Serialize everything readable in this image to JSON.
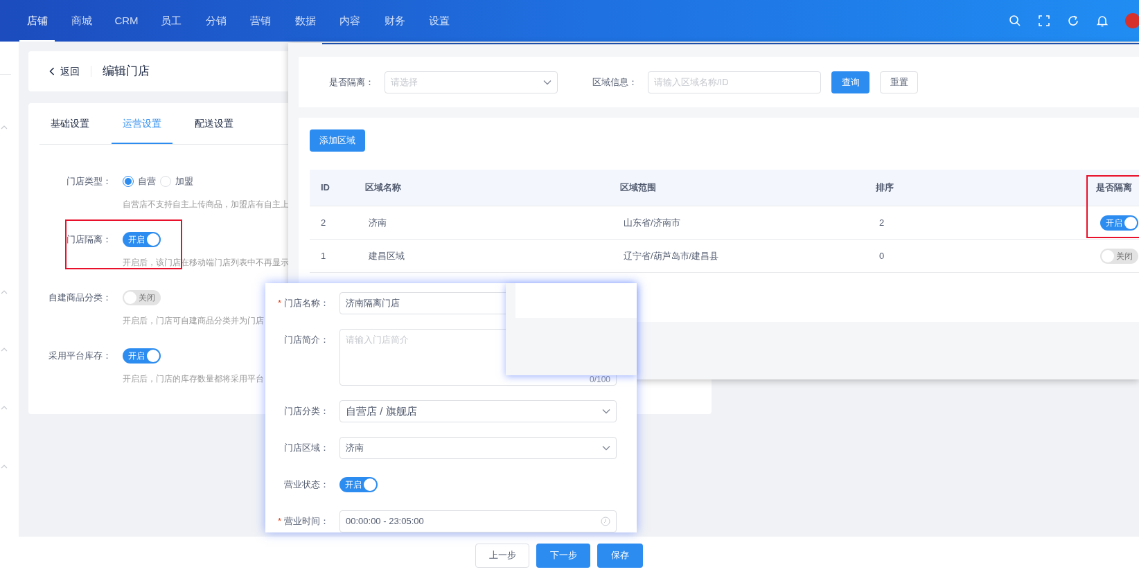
{
  "nav": {
    "items": [
      {
        "label": "店铺",
        "selected": true
      },
      {
        "label": "商城",
        "selected": false
      },
      {
        "label": "CRM",
        "selected": false
      },
      {
        "label": "员工",
        "selected": false
      },
      {
        "label": "分销",
        "selected": false
      },
      {
        "label": "营销",
        "selected": false
      },
      {
        "label": "数据",
        "selected": false
      },
      {
        "label": "内容",
        "selected": false
      },
      {
        "label": "财务",
        "selected": false
      },
      {
        "label": "设置",
        "selected": false
      }
    ]
  },
  "header": {
    "back": "返回",
    "title": "编辑门店"
  },
  "tabs": [
    {
      "label": "基础设置",
      "selected": false
    },
    {
      "label": "运营设置",
      "selected": true
    },
    {
      "label": "配送设置",
      "selected": false
    }
  ],
  "settings": {
    "rows": [
      {
        "kind": "radio",
        "label": "门店类型：",
        "options": [
          {
            "label": "自营",
            "selected": true
          },
          {
            "label": "加盟",
            "selected": false
          }
        ],
        "hint": "自营店不支持自主上传商品，加盟店有自主上"
      },
      {
        "kind": "switch",
        "label": "门店隔离：",
        "on": true,
        "switch_text": "开启",
        "hint": "开启后，该门店在移动端门店列表中不再显示",
        "highlighted": true
      },
      {
        "kind": "switch",
        "label": "自建商品分类：",
        "on": false,
        "switch_text": "关闭",
        "hint": "开启后，门店可自建商品分类并为门店",
        "highlighted": false
      },
      {
        "kind": "switch",
        "label": "采用平台库存：",
        "on": true,
        "switch_text": "开启",
        "hint": "开启后，门店的库存数量都将采用平台",
        "highlighted": false
      }
    ]
  },
  "region_panel": {
    "filters": [
      {
        "kind": "select",
        "label": "是否隔离：",
        "placeholder": "请选择"
      },
      {
        "kind": "input",
        "label": "区域信息：",
        "placeholder": "请输入区域名称/ID"
      }
    ],
    "buttons": [
      {
        "kind": "primary",
        "label": "查询"
      },
      {
        "kind": "default",
        "label": "重置"
      }
    ],
    "add_button": "添加区域",
    "table": {
      "columns": [
        "ID",
        "区域名称",
        "区域范围",
        "排序",
        "是否隔离"
      ],
      "rows": [
        {
          "cells": [
            "2",
            "济南",
            "山东省/济南市",
            "2"
          ],
          "isolation": {
            "on": true,
            "text": "开启"
          },
          "highlighted": true
        },
        {
          "cells": [
            "1",
            "建昌区域",
            "辽宁省/葫芦岛市/建昌县",
            "0"
          ],
          "isolation": {
            "on": false,
            "text": "关闭"
          },
          "highlighted": false
        }
      ]
    }
  },
  "store_form": {
    "required_mark": "*",
    "fields": [
      {
        "kind": "input",
        "label": "门店名称：",
        "required": true,
        "value": "济南隔离门店"
      },
      {
        "kind": "textarea",
        "label": "门店简介：",
        "required": false,
        "placeholder": "请输入门店简介",
        "counter": "0/100"
      },
      {
        "kind": "select",
        "label": "门店分类：",
        "required": false,
        "value": "自营店 / 旗舰店"
      },
      {
        "kind": "select",
        "label": "门店区域：",
        "required": false,
        "value": "济南"
      },
      {
        "kind": "switch",
        "label": "营业状态：",
        "required": false,
        "on": true,
        "switch_text": "开启"
      },
      {
        "kind": "time",
        "label": "营业时间：",
        "required": true,
        "value": "00:00:00 - 23:05:00"
      }
    ]
  },
  "footer": {
    "buttons": [
      {
        "kind": "default",
        "label": "上一步"
      },
      {
        "kind": "primary",
        "label": "下一步"
      },
      {
        "kind": "primary",
        "label": "保存"
      }
    ]
  }
}
